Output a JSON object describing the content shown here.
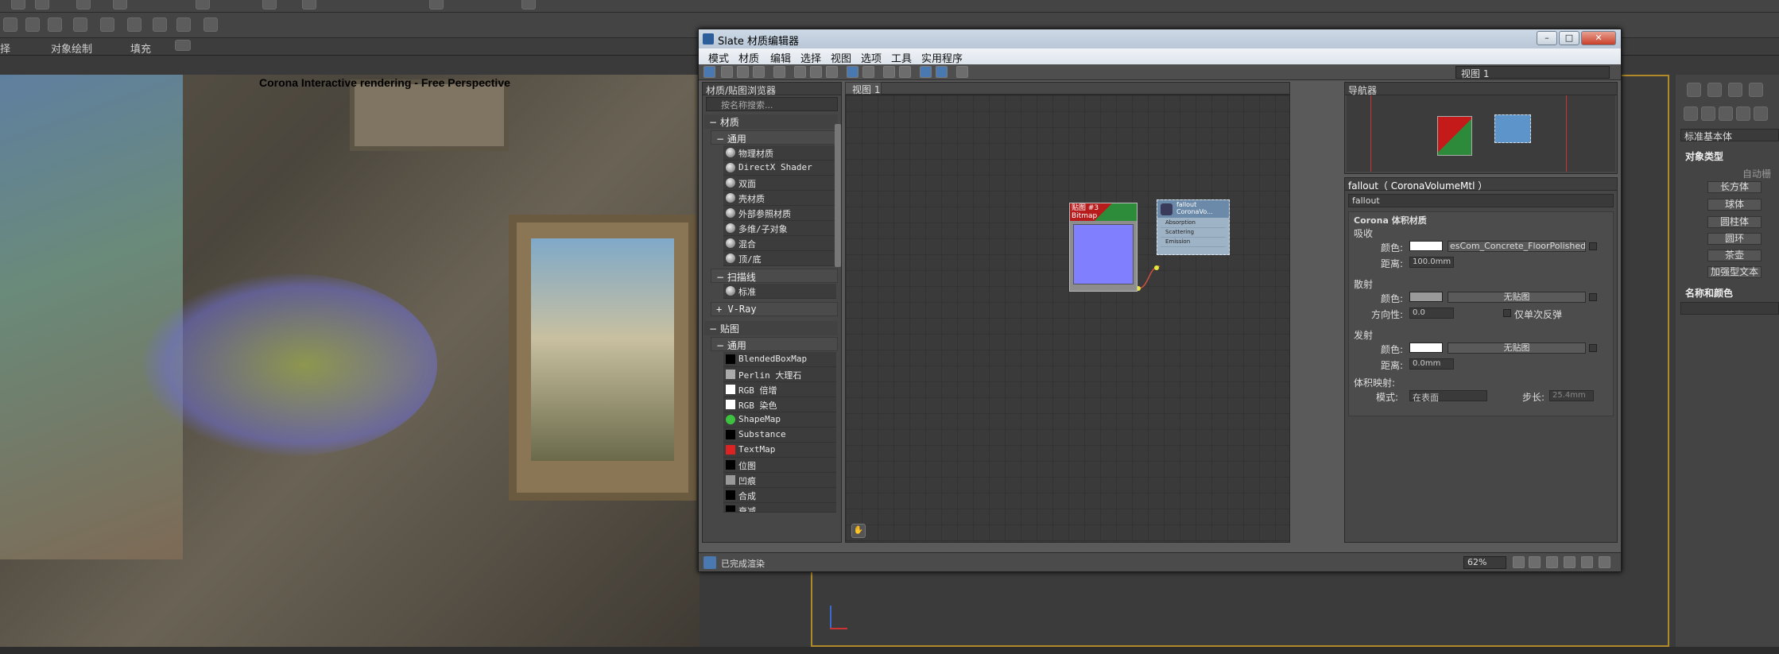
{
  "ribbon": {
    "items": [
      "择",
      "对象绘制",
      "填充"
    ]
  },
  "viewport": {
    "caption": "Corona Interactive rendering - Free Perspective"
  },
  "slate": {
    "title": "Slate 材质编辑器",
    "controls": {
      "min": "–",
      "max": "□",
      "close": "✕"
    },
    "menu": [
      "模式",
      "材质",
      "编辑",
      "选择",
      "视图",
      "选项",
      "工具",
      "实用程序"
    ],
    "view_select": "视图 1",
    "browser": {
      "title": "材质/贴图浏览器",
      "search_placeholder": "按名称搜索...",
      "group_materials": "材质",
      "sub_general": "通用",
      "materials_general": [
        "物理材质",
        "DirectX Shader",
        "双面",
        "壳材质",
        "外部参照材质",
        "多维/子对象",
        "混合",
        "顶/底"
      ],
      "sub_scanline": "扫描线",
      "materials_scanline": [
        "标准"
      ],
      "vray": "V-Ray",
      "group_maps": "贴图",
      "sub_maps_general": "通用",
      "maps_general": [
        "BlendedBoxMap",
        "Perlin 大理石",
        "RGB 倍增",
        "RGB 染色",
        "ShapeMap",
        "Substance",
        "TextMap",
        "位图",
        "凹痕",
        "合成",
        "衰减"
      ]
    },
    "view_tab": "视图 1",
    "nodes": {
      "bitmap": {
        "title": "贴图 #3",
        "subtitle": "Bitmap"
      },
      "volume": {
        "title": "fallout",
        "subtitle": "CoronaVo...",
        "slots": [
          "Absorption",
          "Scattering",
          "Emission"
        ]
      }
    },
    "navigator_title": "导航器",
    "params": {
      "header": "fallout（ CoronaVolumeMtl ）",
      "name": "fallout",
      "rollout_title": "Corona 体积材质",
      "absorb": "吸收",
      "color_label": "颜色:",
      "absorb_map": "esCom_Concrete_FloorPolished",
      "distance_label": "距离:",
      "absorb_distance": "100.0mm",
      "scatter": "散射",
      "no_map": "无贴图",
      "direction_label": "方向性:",
      "direction_value": "0.0",
      "single_bounce": "仅单次反弹",
      "emit": "发射",
      "emit_distance": "0.0mm",
      "volume_mapping": "体积映射:",
      "mode_label": "模式:",
      "mode_value": "在表面",
      "step_label": "步长:",
      "step_value": "25.4mm"
    },
    "status": {
      "text": "已完成渲染",
      "zoom": "62%"
    }
  },
  "command_panel": {
    "category": "标准基本体",
    "object_type": "对象类型",
    "autogrid": "自动栅格",
    "buttons": [
      "长方体",
      "球体",
      "圆柱体",
      "圆环",
      "茶壶",
      "加强型文本"
    ],
    "name_color": "名称和颜色"
  },
  "colors": {
    "accent": "#b08a2a",
    "bitmap_swatch": "#8080ff",
    "node_blue": "#5d94c9"
  }
}
